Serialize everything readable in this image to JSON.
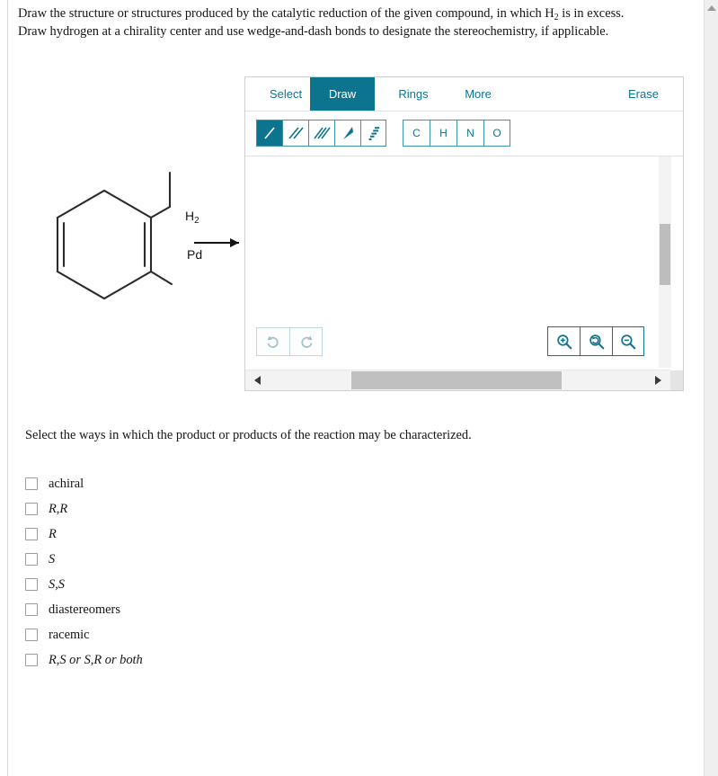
{
  "prompt": {
    "line1_before": "Draw the structure or structures produced by the catalytic reduction of the given compound, in which H",
    "line1_sub": "2",
    "line1_after": " is in excess.",
    "line2": "Draw hydrogen at a chirality center and use wedge-and-dash bonds to designate the stereochemistry, if applicable."
  },
  "reaction": {
    "reagent_main": "H",
    "reagent_sub": "2",
    "catalyst": "Pd",
    "substrate_description": "1-ethyl-2-methylcyclohexa-1,3-diene"
  },
  "sketcher": {
    "tabs": [
      {
        "label": "Select",
        "active": false
      },
      {
        "label": "Draw",
        "active": true
      },
      {
        "label": "Rings",
        "active": false
      },
      {
        "label": "More",
        "active": false
      }
    ],
    "erase_label": "Erase",
    "bond_tools": [
      {
        "name": "single-bond",
        "selected": true
      },
      {
        "name": "double-bond",
        "selected": false
      },
      {
        "name": "triple-bond",
        "selected": false
      },
      {
        "name": "wedge-bond",
        "selected": false
      },
      {
        "name": "dash-bond",
        "selected": false
      }
    ],
    "atom_tools": [
      "C",
      "H",
      "N",
      "O"
    ],
    "history_tools": [
      "undo",
      "redo"
    ],
    "zoom_tools": [
      "zoom-in",
      "zoom-reset",
      "zoom-out"
    ],
    "accent_color": "#0d7490"
  },
  "question2": {
    "text": "Select the ways in which the product or products of the reaction may be characterized.",
    "options": [
      {
        "label": "achiral",
        "italic": false,
        "checked": false
      },
      {
        "label": "R,R",
        "italic": true,
        "checked": false
      },
      {
        "label": "R",
        "italic": true,
        "checked": false
      },
      {
        "label": "S",
        "italic": true,
        "checked": false
      },
      {
        "label": "S,S",
        "italic": true,
        "checked": false
      },
      {
        "label": "diastereomers",
        "italic": false,
        "checked": false
      },
      {
        "label": "racemic",
        "italic": false,
        "checked": false
      },
      {
        "label": "R,S or S,R or both",
        "italic": true,
        "checked": false
      }
    ]
  }
}
